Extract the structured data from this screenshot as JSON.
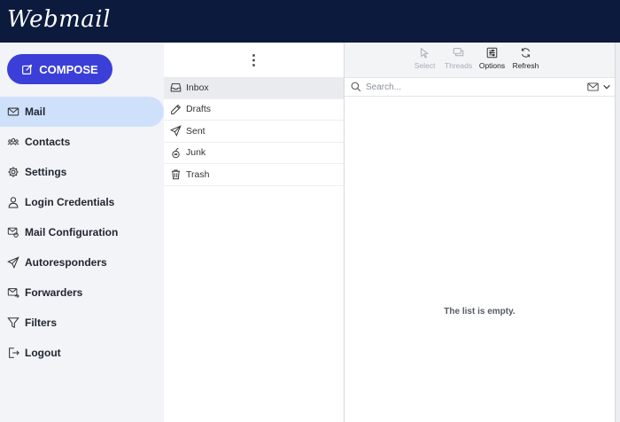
{
  "brand": {
    "title": "Webmail"
  },
  "compose": {
    "label": "COMPOSE"
  },
  "nav": {
    "items": [
      {
        "label": "Mail",
        "icon": "envelope-icon"
      },
      {
        "label": "Contacts",
        "icon": "contacts-icon"
      },
      {
        "label": "Settings",
        "icon": "gear-icon"
      },
      {
        "label": "Login Credentials",
        "icon": "user-icon"
      },
      {
        "label": "Mail Configuration",
        "icon": "mail-config-icon"
      },
      {
        "label": "Autoresponders",
        "icon": "paper-plane-icon"
      },
      {
        "label": "Forwarders",
        "icon": "forward-mail-icon"
      },
      {
        "label": "Filters",
        "icon": "filter-icon"
      },
      {
        "label": "Logout",
        "icon": "logout-icon"
      }
    ],
    "active_index": 0
  },
  "folders": {
    "menu_glyph": "⋮",
    "items": [
      {
        "label": "Inbox",
        "icon": "inbox-icon"
      },
      {
        "label": "Drafts",
        "icon": "pencil-icon"
      },
      {
        "label": "Sent",
        "icon": "paper-plane-icon"
      },
      {
        "label": "Junk",
        "icon": "junk-icon"
      },
      {
        "label": "Trash",
        "icon": "trash-icon"
      }
    ],
    "active_index": 0
  },
  "toolbar": {
    "select_label": "Select",
    "threads_label": "Threads",
    "options_label": "Options",
    "refresh_label": "Refresh"
  },
  "search": {
    "placeholder": "Search..."
  },
  "messages": {
    "empty_text": "The list is empty."
  },
  "colors": {
    "topbar": "#0c1a3d",
    "accent": "#3b3fd8",
    "active_nav": "#cfe0fb",
    "sidebar_bg": "#f3f4f7"
  }
}
